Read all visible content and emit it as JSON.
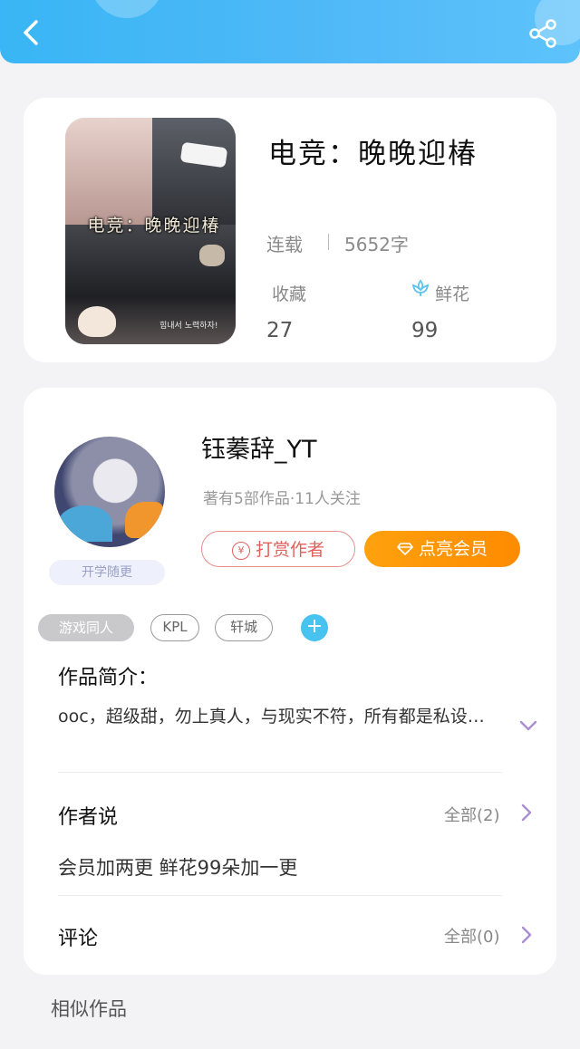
{
  "book": {
    "title": "电竞：晚晚迎椿",
    "cover_title": "电竞：晚晚迎椿",
    "cover_caption": "힘내서 노력하자!",
    "status": "连载",
    "word_count": "5652字",
    "favorites_label": "收藏",
    "favorites_count": "27",
    "flowers_label": "鲜花",
    "flowers_count": "99"
  },
  "author": {
    "name": "钰蓁辞_YT",
    "meta": "著有5部作品·11人关注",
    "badge": "开学随更",
    "reward_label": "打赏作者",
    "reward_icon": "yen-icon",
    "vip_label": "点亮会员",
    "vip_icon": "diamond-icon"
  },
  "tags": [
    "游戏同人",
    "KPL",
    "轩城"
  ],
  "intro": {
    "title": "作品简介：",
    "text": "ooc，超级甜，勿上真人，与现实不符，所有都是私设…"
  },
  "author_note": {
    "title": "作者说",
    "all_label": "全部(2)",
    "text": "会员加两更 鲜花99朵加一更"
  },
  "comments": {
    "title": "评论",
    "all_label": "全部(0)"
  },
  "similar_title": "相似作品",
  "colors": {
    "header_blue": "#4fb8f7",
    "vip_orange": "#ff9a06",
    "reward_red": "#e0605d",
    "tag_add_blue": "#48c3f0",
    "chevron_purple": "#a98fd0"
  }
}
